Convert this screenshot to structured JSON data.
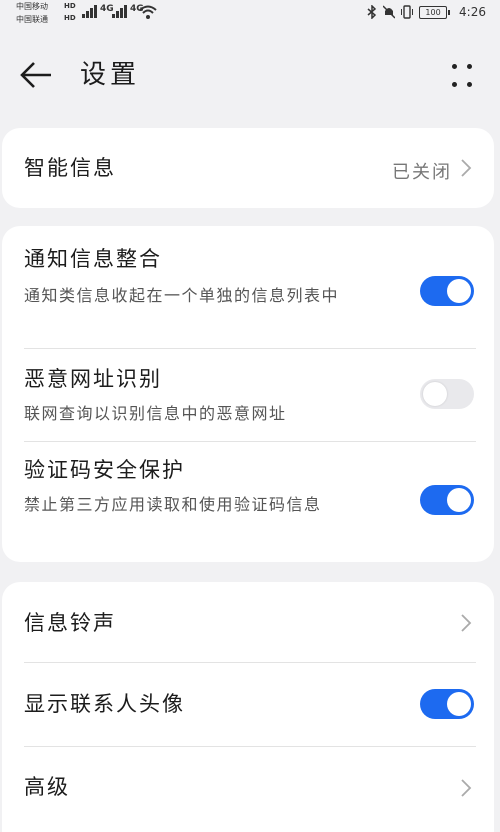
{
  "status_bar": {
    "carrier1": "中国移动",
    "carrier2": "中国联通",
    "hd1": "HD",
    "hd2": "HD",
    "signal1": "4G",
    "signal2": "4G",
    "battery": "100",
    "time": "4:26",
    "icons": [
      "bluetooth-icon",
      "mute-icon",
      "vibrate-icon",
      "wifi-icon",
      "signal-icon"
    ]
  },
  "header": {
    "title": "设置",
    "back_icon": "arrow-left-icon",
    "more_icon": "more-vertical-icon"
  },
  "card1": {
    "smart_message": {
      "title": "智能信息",
      "value": "已关闭"
    }
  },
  "card2": {
    "merge": {
      "title": "通知信息整合",
      "desc": "通知类信息收起在一个单独的信息列表中",
      "enabled": true
    },
    "malicious_url": {
      "title": "恶意网址识别",
      "desc": "联网查询以识别信息中的恶意网址",
      "enabled": false
    },
    "code_protection": {
      "title": "验证码安全保护",
      "desc": "禁止第三方应用读取和使用验证码信息",
      "enabled": true
    }
  },
  "card3": {
    "ringtone": {
      "title": "信息铃声"
    },
    "show_avatar": {
      "title": "显示联系人头像",
      "enabled": true
    },
    "advanced": {
      "title": "高级"
    }
  },
  "colors": {
    "accent": "#1d6af0",
    "background": "#f1f1f3",
    "card": "#ffffff"
  }
}
